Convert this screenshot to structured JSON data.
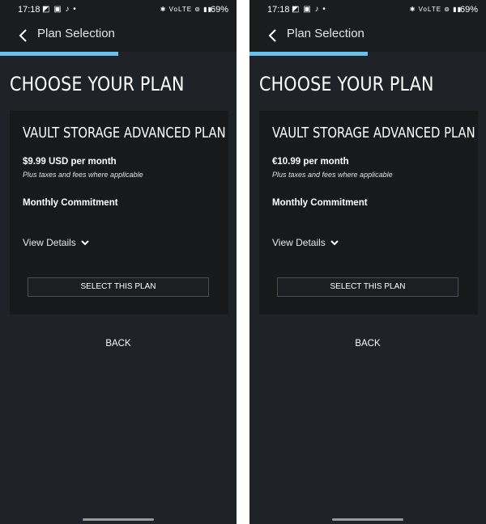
{
  "screens": [
    {
      "status": {
        "time": "17:18",
        "left_icons": "◩ ▣ ♪ •",
        "right_icons": "✱ VoLTE ⊚ ▮▮",
        "battery": "69%"
      },
      "appbar": {
        "title": "Plan Selection",
        "back_icon": "back-arrow-icon"
      },
      "progress": 0.5,
      "heading": "CHOOSE YOUR PLAN",
      "plan": {
        "title": "VAULT STORAGE ADVANCED PLAN",
        "price": "$9.99 USD per month",
        "tax_note": "Plus taxes and fees where applicable",
        "commitment": "Monthly Commitment",
        "view_details": "View Details",
        "select_label": "SELECT THIS PLAN"
      },
      "back_label": "BACK"
    },
    {
      "status": {
        "time": "17:18",
        "left_icons": "◩ ▣ ♪ •",
        "right_icons": "✱ VoLTE ⊚ ▮▮",
        "battery": "69%"
      },
      "appbar": {
        "title": "Plan Selection",
        "back_icon": "back-arrow-icon"
      },
      "progress": 0.5,
      "heading": "CHOOSE YOUR PLAN",
      "plan": {
        "title": "VAULT STORAGE ADVANCED PLAN",
        "price": "€10.99 per month",
        "tax_note": "Plus taxes and fees where applicable",
        "commitment": "Monthly Commitment",
        "view_details": "View Details",
        "select_label": "SELECT THIS PLAN"
      },
      "back_label": "BACK"
    }
  ],
  "colors": {
    "background": "#1f2226",
    "card": "#18191b",
    "accent": "#63c3ec",
    "text": "#ffffff"
  }
}
